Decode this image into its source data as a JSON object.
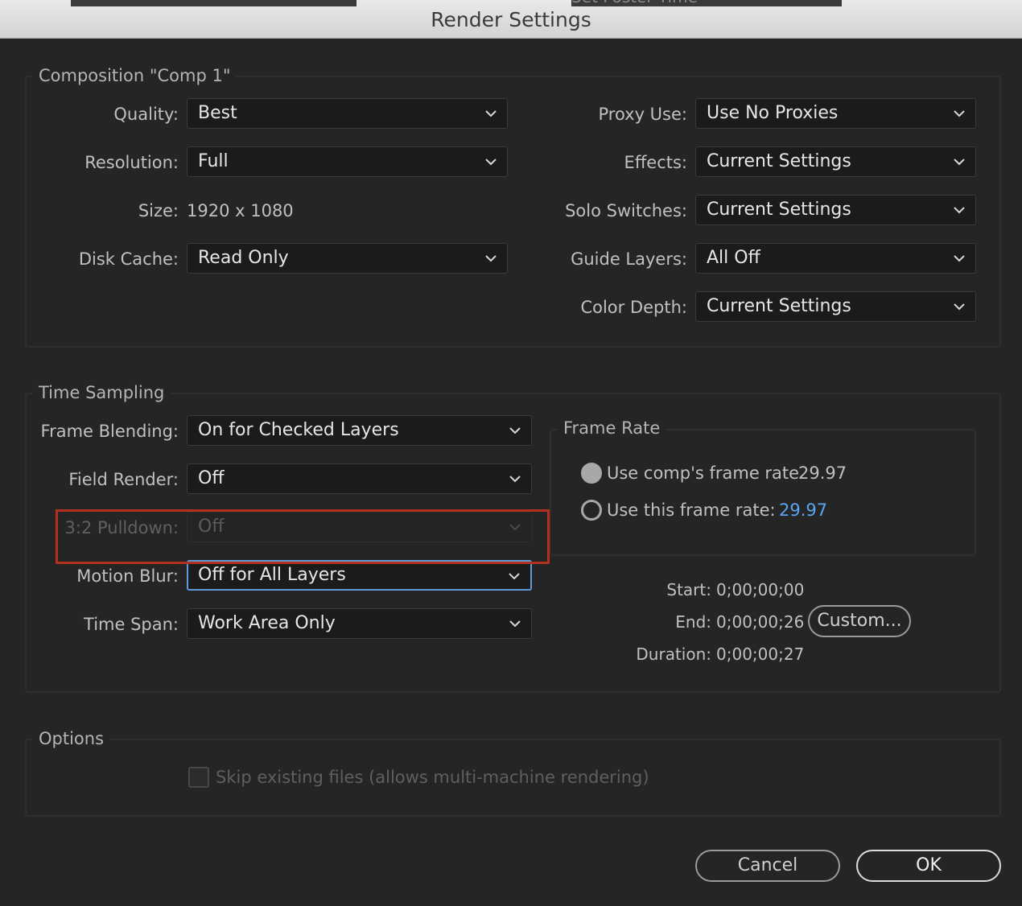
{
  "window": {
    "title": "Render Settings",
    "behind_text": "Set Poster Time"
  },
  "composition": {
    "legend": "Composition \"Comp 1\"",
    "quality": {
      "label": "Quality:",
      "value": "Best"
    },
    "resolution": {
      "label": "Resolution:",
      "value": "Full"
    },
    "size": {
      "label": "Size:",
      "value": "1920 x 1080"
    },
    "disk_cache": {
      "label": "Disk Cache:",
      "value": "Read Only"
    },
    "proxy_use": {
      "label": "Proxy Use:",
      "value": "Use No Proxies"
    },
    "effects": {
      "label": "Effects:",
      "value": "Current Settings"
    },
    "solo_switches": {
      "label": "Solo Switches:",
      "value": "Current Settings"
    },
    "guide_layers": {
      "label": "Guide Layers:",
      "value": "All Off"
    },
    "color_depth": {
      "label": "Color Depth:",
      "value": "Current Settings"
    }
  },
  "time_sampling": {
    "legend": "Time Sampling",
    "frame_blending": {
      "label": "Frame Blending:",
      "value": "On for Checked Layers"
    },
    "field_render": {
      "label": "Field Render:",
      "value": "Off"
    },
    "pulldown": {
      "label": "3:2 Pulldown:",
      "value": "Off",
      "disabled": true
    },
    "motion_blur": {
      "label": "Motion Blur:",
      "value": "Off for All Layers"
    },
    "time_span": {
      "label": "Time Span:",
      "value": "Work Area Only"
    },
    "frame_rate": {
      "legend": "Frame Rate",
      "use_comp_label": "Use comp's frame rate",
      "use_comp_value": "29.97",
      "use_this_label": "Use this frame rate:",
      "use_this_value": "29.97",
      "selected": "use_comp"
    },
    "start": {
      "label": "Start:",
      "value": "0;00;00;00"
    },
    "end": {
      "label": "End:",
      "value": "0;00;00;26"
    },
    "duration": {
      "label": "Duration:",
      "value": "0;00;00;27"
    },
    "custom_button": "Custom..."
  },
  "options": {
    "legend": "Options",
    "skip_existing_label": "Skip existing files (allows multi-machine rendering)",
    "skip_existing_checked": false
  },
  "buttons": {
    "cancel": "Cancel",
    "ok": "OK"
  },
  "colors": {
    "highlight": "#b1301f",
    "link_value": "#5aa6f2",
    "focus_border": "#5f9ad8"
  }
}
